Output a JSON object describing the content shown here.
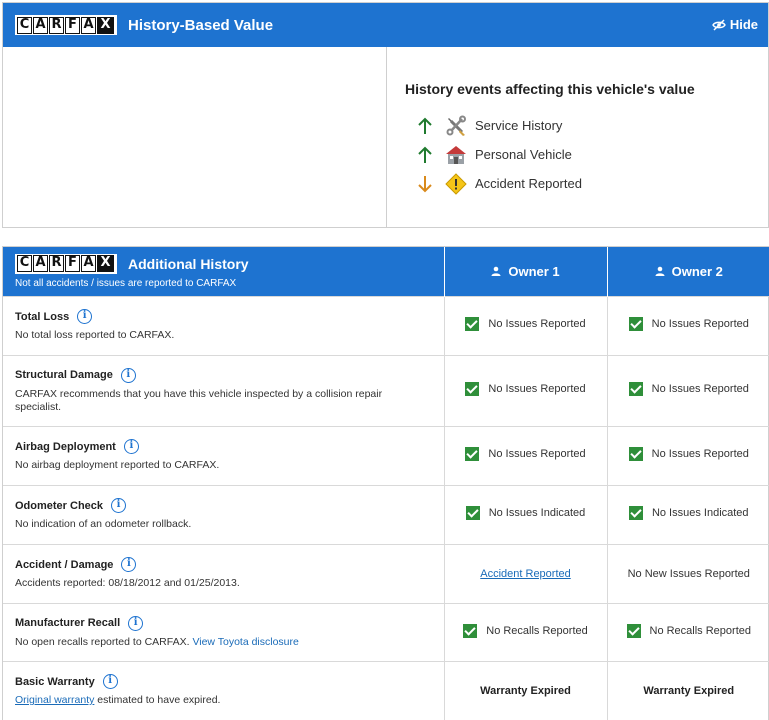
{
  "history_value": {
    "logo_letters": [
      "C",
      "A",
      "R",
      "F",
      "A",
      "X"
    ],
    "title": "History-Based Value",
    "hide_label": "Hide",
    "events_title": "History events affecting this vehicle's value",
    "events": [
      {
        "label": "Service History",
        "direction": "up",
        "icon": "wrench-screwdriver-icon",
        "arrow_color": "#1f7a2e"
      },
      {
        "label": "Personal Vehicle",
        "direction": "up",
        "icon": "house-icon",
        "arrow_color": "#1f7a2e"
      },
      {
        "label": "Accident Reported",
        "direction": "down",
        "icon": "warning-diamond-icon",
        "arrow_color": "#d98a1c"
      }
    ]
  },
  "additional_history": {
    "logo_letters": [
      "C",
      "A",
      "R",
      "F",
      "A",
      "X"
    ],
    "title": "Additional History",
    "subtitle": "Not all accidents / issues are reported to CARFAX",
    "owners": [
      "Owner 1",
      "Owner 2"
    ],
    "rows": [
      {
        "title": "Total Loss",
        "desc": "No total loss reported to CARFAX.",
        "owner1": "No Issues Reported",
        "owner2": "No Issues Reported"
      },
      {
        "title": "Structural Damage",
        "desc": "CARFAX recommends that you have this vehicle inspected by a collision repair specialist.",
        "owner1": "No Issues Reported",
        "owner2": "No Issues Reported"
      },
      {
        "title": "Airbag Deployment",
        "desc": "No airbag deployment reported to CARFAX.",
        "owner1": "No Issues Reported",
        "owner2": "No Issues Reported"
      },
      {
        "title": "Odometer Check",
        "desc": "No indication of an odometer rollback.",
        "owner1": "No Issues Indicated",
        "owner2": "No Issues Indicated"
      },
      {
        "title": "Accident / Damage",
        "desc": "Accidents reported: 08/18/2012 and 01/25/2013.",
        "owner1": "Accident Reported",
        "owner2": "No New Issues Reported"
      },
      {
        "title": "Manufacturer Recall",
        "desc": "No open recalls reported to CARFAX.",
        "desc_link": "View Toyota disclosure",
        "owner1": "No Recalls Reported",
        "owner2": "No Recalls Reported"
      },
      {
        "title": "Basic Warranty",
        "desc_link": "Original warranty",
        "desc": "estimated to have expired.",
        "owner1": "Warranty Expired",
        "owner2": "Warranty Expired"
      }
    ]
  },
  "colors": {
    "header_blue": "#1e73d0",
    "check_green": "#2f8f3a",
    "link_blue": "#1a6bb8"
  }
}
